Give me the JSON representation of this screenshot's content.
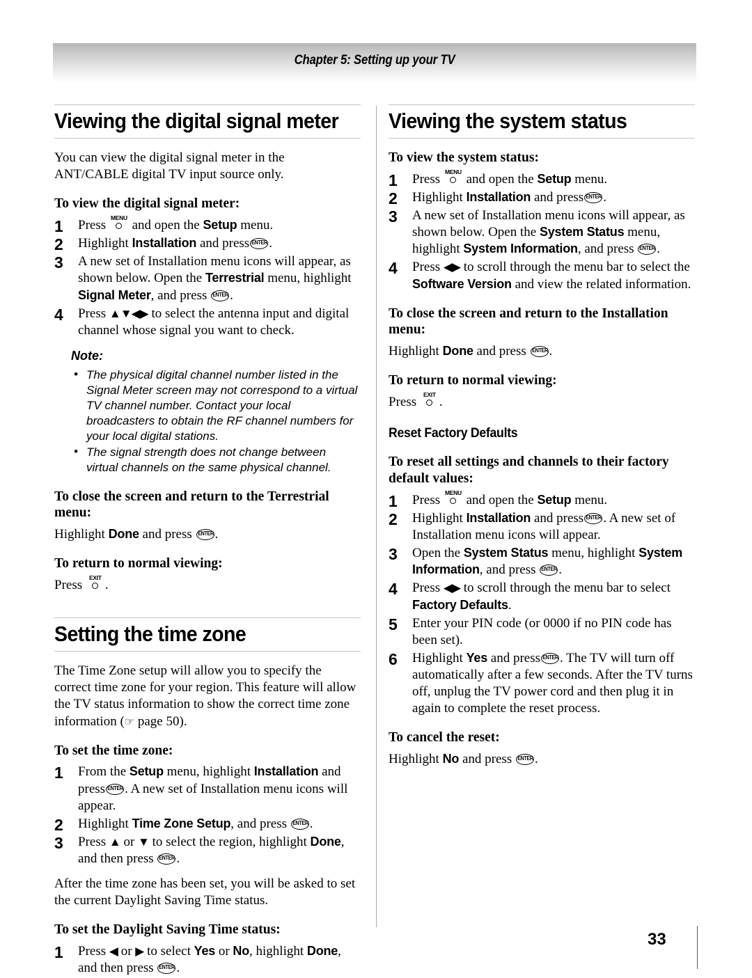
{
  "header": {
    "chapter": "Chapter 5: Setting up your TV"
  },
  "folio": {
    "page_number": "33"
  },
  "keys": {
    "menu": "MENU",
    "exit": "EXIT",
    "enter": "ENTER"
  },
  "left_column": {
    "heading1": "Viewing the digital signal meter",
    "intro": "You can view the digital signal meter in the ANT/CABLE digital TV input source only.",
    "sub1": "To view the digital signal meter:",
    "steps1": {
      "n1": "1",
      "s1_a": "Press",
      "s1_b": "and open the",
      "s1_bold": "Setup",
      "s1_c": "menu.",
      "n2": "2",
      "s2_a": "Highlight",
      "s2_bold": "Installation",
      "s2_b": "and press",
      "s2_c": ".",
      "n3": "3",
      "s3_a": "A new set of Installation menu icons will appear, as shown below. Open the",
      "s3_bold1": "Terrestrial",
      "s3_b": "menu, highlight",
      "s3_bold2": "Signal Meter",
      "s3_c": ", and press",
      "s3_d": ".",
      "n4": "4",
      "s4_a": "Press",
      "s4_arrows": "▲▼◀▶",
      "s4_b": "to select the antenna input and digital channel whose signal you want to check."
    },
    "note_label": "Note:",
    "notes": [
      "The physical digital channel number listed in the Signal Meter screen may not correspond to a virtual TV channel number. Contact your local broadcasters to obtain the RF channel numbers for your local digital stations.",
      "The signal strength does not change between virtual channels on the same physical channel."
    ],
    "sub2": "To close the screen and return to the Terrestrial menu:",
    "sub2_line_a": "Highlight",
    "sub2_bold": "Done",
    "sub2_line_b": "and press",
    "sub2_line_c": ".",
    "sub3": "To return to normal viewing:",
    "sub3_line_a": "Press",
    "sub3_line_b": ".",
    "heading2": "Setting the time zone",
    "tz_intro_a": "The Time Zone setup will allow you to specify the correct time zone for your region. This feature will allow the TV status information to show the correct time zone information (",
    "tz_hand": "☞",
    "tz_intro_b": " page 50).",
    "sub4": "To set the time zone:",
    "steps2": {
      "n1": "1",
      "s1_a": "From the",
      "s1_bold1": "Setup",
      "s1_b": "menu, highlight",
      "s1_bold2": "Installation",
      "s1_c": "and press",
      "s1_d": ". A new set of Installation menu icons will appear.",
      "n2": "2",
      "s2_a": "Highlight",
      "s2_bold": "Time Zone Setup",
      "s2_b": ", and press",
      "s2_c": ".",
      "n3": "3",
      "s3_a": "Press",
      "s3_arrow1": "▲",
      "s3_b": "or",
      "s3_arrow2": "▼",
      "s3_c": "to select the region, highlight",
      "s3_bold": "Done",
      "s3_d": ", and then press",
      "s3_e": "."
    },
    "tz_after": "After the time zone has been set, you will be asked to set the current Daylight Saving Time status.",
    "sub5": "To set the Daylight Saving Time status:",
    "steps3": {
      "n1": "1",
      "s1_a": "Press",
      "s1_arrow1": "◀",
      "s1_b": "or",
      "s1_arrow2": "▶",
      "s1_c": "to select",
      "s1_bold1": "Yes",
      "s1_d": "or",
      "s1_bold2": "No",
      "s1_e": ", highlight",
      "s1_bold3": "Done",
      "s1_f": ", and then press",
      "s1_g": "."
    }
  },
  "right_column": {
    "heading1": "Viewing the system status",
    "sub1": "To view the system status:",
    "steps1": {
      "n1": "1",
      "s1_a": "Press",
      "s1_b": "and open the",
      "s1_bold": "Setup",
      "s1_c": "menu.",
      "n2": "2",
      "s2_a": "Highlight",
      "s2_bold": "Installation",
      "s2_b": "and press",
      "s2_c": ".",
      "n3": "3",
      "s3_a": "A new set of Installation menu icons will appear, as shown below. Open the",
      "s3_bold1": "System Status",
      "s3_b": "menu, highlight",
      "s3_bold2": "System Information",
      "s3_c": ", and press",
      "s3_d": ".",
      "n4": "4",
      "s4_a": "Press",
      "s4_arrows": "◀▶",
      "s4_b": "to scroll through the menu bar to select the",
      "s4_bold": "Software Version",
      "s4_c": "and view the related information."
    },
    "sub2": "To close the screen and return to the Installation menu:",
    "sub2_line_a": "Highlight",
    "sub2_bold": "Done",
    "sub2_line_b": "and press",
    "sub2_line_c": ".",
    "sub3": "To return to normal viewing:",
    "sub3_line_a": "Press",
    "sub3_line_b": ".",
    "subhead": "Reset Factory Defaults",
    "sub4": "To reset all settings and channels to their factory default values:",
    "steps2": {
      "n1": "1",
      "s1_a": "Press",
      "s1_b": "and open the",
      "s1_bold": "Setup",
      "s1_c": "menu.",
      "n2": "2",
      "s2_a": "Highlight",
      "s2_bold": "Installation",
      "s2_b": "and press",
      "s2_c": ". A new set of Installation menu icons will appear.",
      "n3": "3",
      "s3_a": "Open the",
      "s3_bold1": "System Status",
      "s3_b": "menu, highlight",
      "s3_bold2": "System Information",
      "s3_c": ", and press",
      "s3_d": ".",
      "n4": "4",
      "s4_a": "Press",
      "s4_arrows": "◀▶",
      "s4_b": "to scroll through the menu bar to select",
      "s4_bold": "Factory Defaults",
      "s4_c": ".",
      "n5": "5",
      "s5_a": "Enter your PIN code (or 0000 if no PIN code has been set).",
      "n6": "6",
      "s6_a": "Highlight",
      "s6_bold": "Yes",
      "s6_b": "and press",
      "s6_c": ". The TV will turn off automatically after a few seconds. After the TV turns off, unplug the TV power cord and then plug it in again to complete the reset process."
    },
    "sub5": "To cancel the reset:",
    "sub5_line_a": "Highlight",
    "sub5_bold": "No",
    "sub5_line_b": "and press",
    "sub5_line_c": "."
  }
}
